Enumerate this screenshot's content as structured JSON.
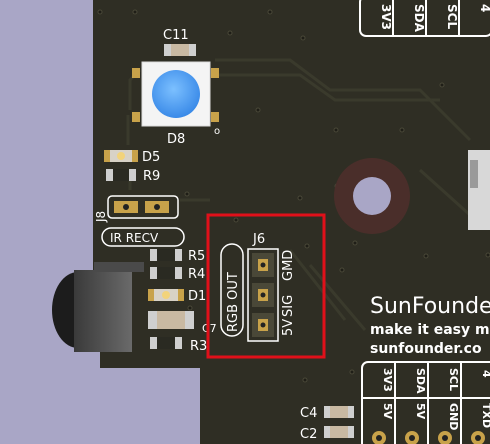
{
  "board": {
    "colors": {
      "pcb": "#2f2e24",
      "background": "#a9a6c6",
      "highlight": "#e0101a",
      "silk": "#ffffff",
      "gold": "#c8a24a",
      "led_blue": "#4a9ef0"
    },
    "components": {
      "c11": "C11",
      "d8": "D8",
      "d5": "D5",
      "r9": "R9",
      "j8": "J8",
      "ir_recv": "IR RECV",
      "r5": "R5",
      "r4": "R4",
      "d1": "D1",
      "c7": "C7",
      "r3": "R3",
      "j6": "J6",
      "rgb_out": "RGB OUT",
      "pin_5v": "5V",
      "pin_sig": "SIG",
      "pin_gmd": "GMD",
      "c4": "C4",
      "c2": "C2",
      "pin_dot": "o"
    },
    "top_header": [
      "3V3",
      "SDA",
      "SCL",
      "4"
    ],
    "brand": {
      "name": "SunFounder",
      "tagline": "make it easy m",
      "url": "sunfounder.co"
    },
    "bottom_header": {
      "top_row": [
        "3V3",
        "SDA",
        "SCL",
        "4"
      ],
      "bottom_row": [
        "5V",
        "5V",
        "GND",
        "TXD"
      ]
    }
  }
}
